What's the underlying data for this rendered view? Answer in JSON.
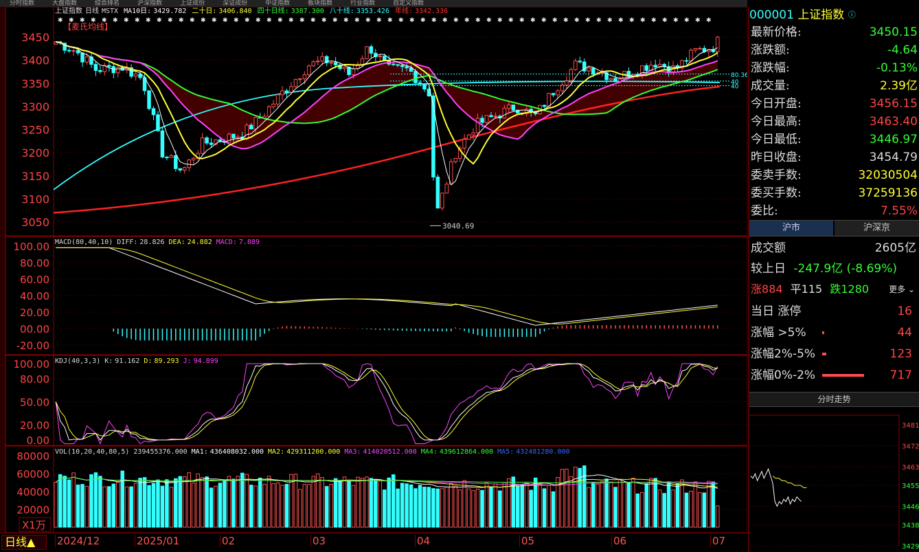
{
  "topbar": {
    "tabs": [
      "分时指数",
      "大盘指数",
      "综合排名",
      "沪深指数",
      "上证成份",
      "深证成份",
      "中证指数",
      "板块指数",
      "行业指数",
      "自定义指数"
    ]
  },
  "chart_header": {
    "code": "上证指数",
    "period": "日线",
    "indicator": "MSTX",
    "ma_labels": [
      {
        "label": "MA10日:",
        "value": "3429.782",
        "color": "#ffffff"
      },
      {
        "label": "二十日:",
        "value": "3406.840",
        "color": "#ffff33"
      },
      {
        "label": "四十日线:",
        "value": "3387.300",
        "color": "#33ff33"
      },
      {
        "label": "八十线:",
        "value": "3353.426",
        "color": "#33ffff"
      },
      {
        "label": "年线:",
        "value": "3342.336",
        "color": "#ff3333"
      }
    ],
    "custom_label": "【麦氏均线】"
  },
  "y_main": [
    "3450",
    "3400",
    "3350",
    "3300",
    "3250",
    "3200",
    "3150",
    "3100",
    "3050"
  ],
  "low_label": "3040.69",
  "right_tags": [
    "80.36",
    "40",
    "40"
  ],
  "macd": {
    "header": "MACD(80,40,10)",
    "diff_label": "DIFF:",
    "diff": "28.826",
    "dea_label": "DEA:",
    "dea": "24.882",
    "macd_label": "MACD:",
    "macd": "7.889",
    "y": [
      "100.00",
      "80.00",
      "60.00",
      "40.00",
      "20.00",
      "00.00",
      "-20.00"
    ]
  },
  "kdj": {
    "header": "KDJ(40,3,3)",
    "k_label": "K:",
    "k": "91.162",
    "d_label": "D:",
    "d": "89.293",
    "j_label": "J:",
    "j": "94.899",
    "y": [
      "100.00",
      "80.00",
      "50.00",
      "20.00",
      "0.00"
    ]
  },
  "vol": {
    "header": "VOL(10,20,40,80,5)",
    "value": "239455376.000",
    "ma1_label": "MA1:",
    "ma1": "436408032.000",
    "ma2_label": "MA2:",
    "ma2": "429311200.000",
    "ma3_label": "MA3:",
    "ma3": "414020512.000",
    "ma4_label": "MA4:",
    "ma4": "439612864.000",
    "ma5_label": "MA5:",
    "ma5": "432481280.000",
    "y": [
      "80000",
      "60000",
      "40000",
      "20000"
    ],
    "unit": "X1万"
  },
  "x_axis": [
    "2024/12",
    "2025/01",
    "02",
    "03",
    "04",
    "05",
    "06",
    "07"
  ],
  "period_button": "日线▲",
  "quote": {
    "code": "000001",
    "name": "上证指数",
    "rows": [
      {
        "k": "最新价格:",
        "v": "3450.15",
        "c": "#33ff33"
      },
      {
        "k": "涨跌额:",
        "v": "-4.64",
        "c": "#33ff33"
      },
      {
        "k": "涨跌幅:",
        "v": "-0.13%",
        "c": "#33ff33"
      },
      {
        "k": "成交量:",
        "v": "2.39亿",
        "c": "#ffff33"
      },
      {
        "k": "今日开盘:",
        "v": "3456.15",
        "c": "#ff4444"
      },
      {
        "k": "今日最高:",
        "v": "3463.40",
        "c": "#ff4444"
      },
      {
        "k": "今日最低:",
        "v": "3446.97",
        "c": "#33ff33"
      },
      {
        "k": "昨日收盘:",
        "v": "3454.79",
        "c": "#dddddd"
      },
      {
        "k": "委卖手数:",
        "v": "32030504",
        "c": "#ffff33"
      },
      {
        "k": "委买手数:",
        "v": "37259136",
        "c": "#ffff33"
      },
      {
        "k": "委比:",
        "v": "7.55%",
        "c": "#ff4444"
      }
    ]
  },
  "market_tabs": [
    "沪市",
    "沪深京"
  ],
  "stats": {
    "turnover_label": "成交额",
    "turnover": "2605亿",
    "compare_label": "较上日",
    "compare": "-247.9亿 (-8.69%)",
    "up_label": "涨",
    "up": "884",
    "flat_label": "平",
    "flat": "115",
    "down_label": "跌",
    "down": "1280",
    "more": "更多",
    "rows": [
      {
        "k": "当日 涨停",
        "v": "16",
        "bar": 0
      },
      {
        "k": "涨幅 >5%",
        "v": "44",
        "bar": 0.02
      },
      {
        "k": "涨幅2%-5%",
        "v": "123",
        "bar": 0.05
      },
      {
        "k": "涨幅0%-2%",
        "v": "717",
        "bar": 0.55
      }
    ]
  },
  "intraday": {
    "title": "分时走势",
    "y": [
      "3481",
      "3472",
      "3463",
      "3455",
      "3446",
      "3438",
      "3429"
    ]
  }
}
